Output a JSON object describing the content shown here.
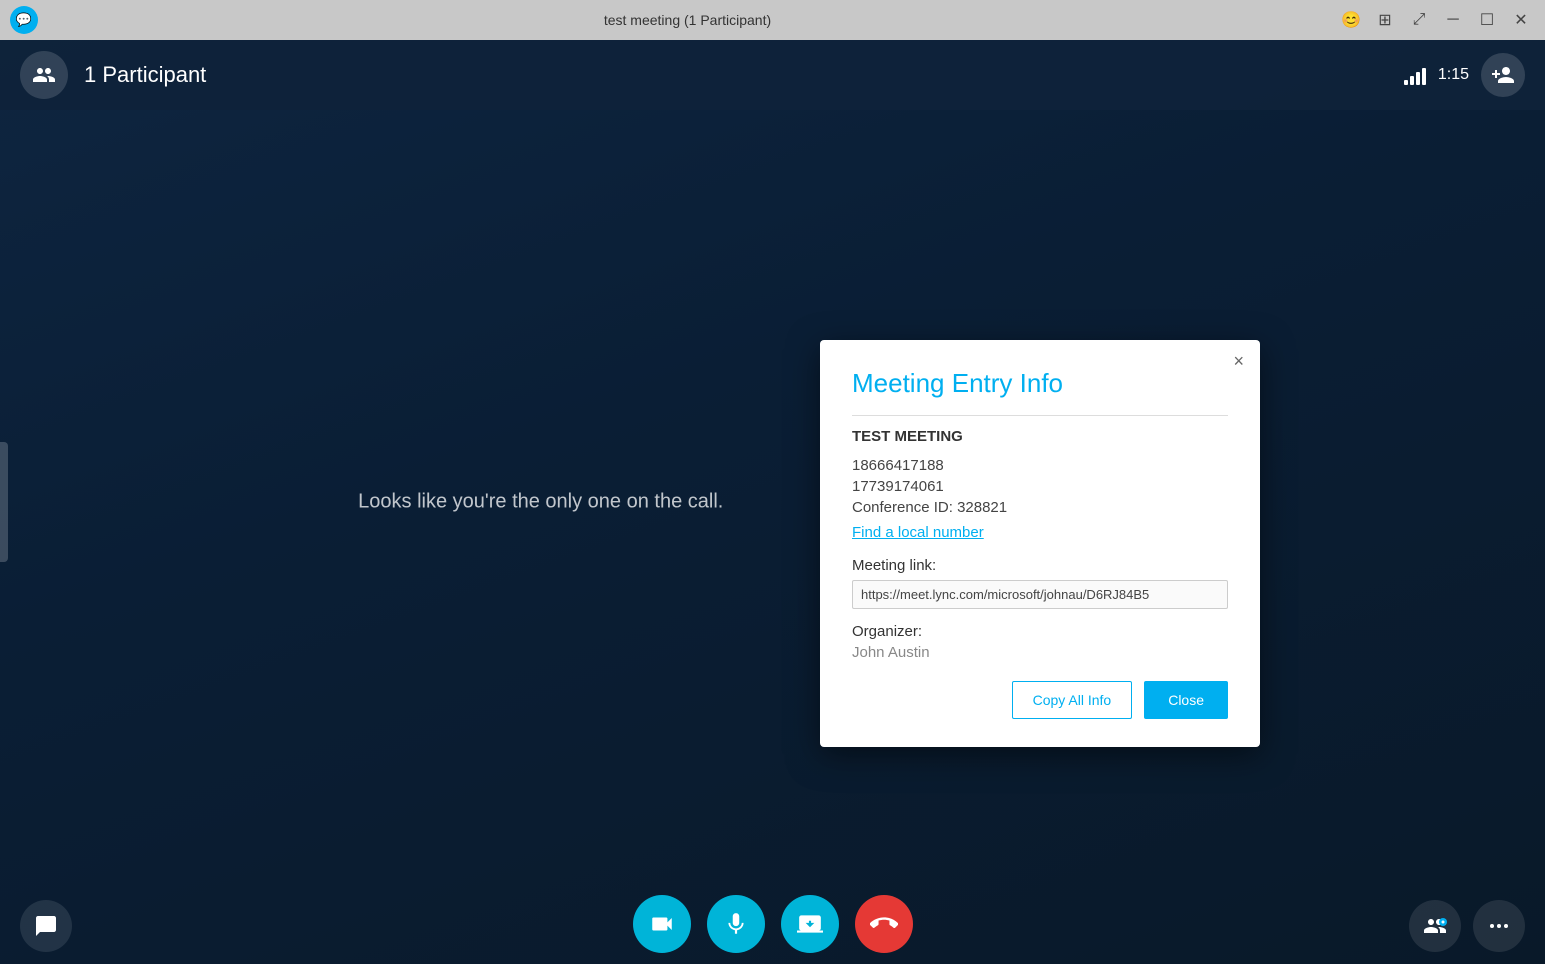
{
  "titleBar": {
    "title": "test meeting (1 Participant)",
    "skype_label": "S"
  },
  "topBar": {
    "participants_label": "1 Participant",
    "call_time": "1:15"
  },
  "mainArea": {
    "center_message": "Looks like you're the only one on the call."
  },
  "bottomToolbar": {
    "video_label": "Video",
    "mic_label": "Microphone",
    "screen_label": "Screen Share",
    "end_call_label": "End Call",
    "more_label": "More Options",
    "participants_settings_label": "Participant Settings",
    "chat_label": "Chat"
  },
  "modal": {
    "title": "Meeting Entry Info",
    "close_label": "×",
    "meeting_name": "TEST MEETING",
    "phone1": "18666417188",
    "phone2": "17739174061",
    "conference_id_label": "Conference ID:",
    "conference_id_value": "328821",
    "find_local_number": "Find a local number",
    "meeting_link_label": "Meeting link:",
    "meeting_link_url": "https://meet.lync.com/microsoft/johnau/D6RJ84B5",
    "organizer_label": "Organizer:",
    "organizer_value": "John Austin",
    "copy_all_label": "Copy All Info",
    "close_button_label": "Close"
  }
}
